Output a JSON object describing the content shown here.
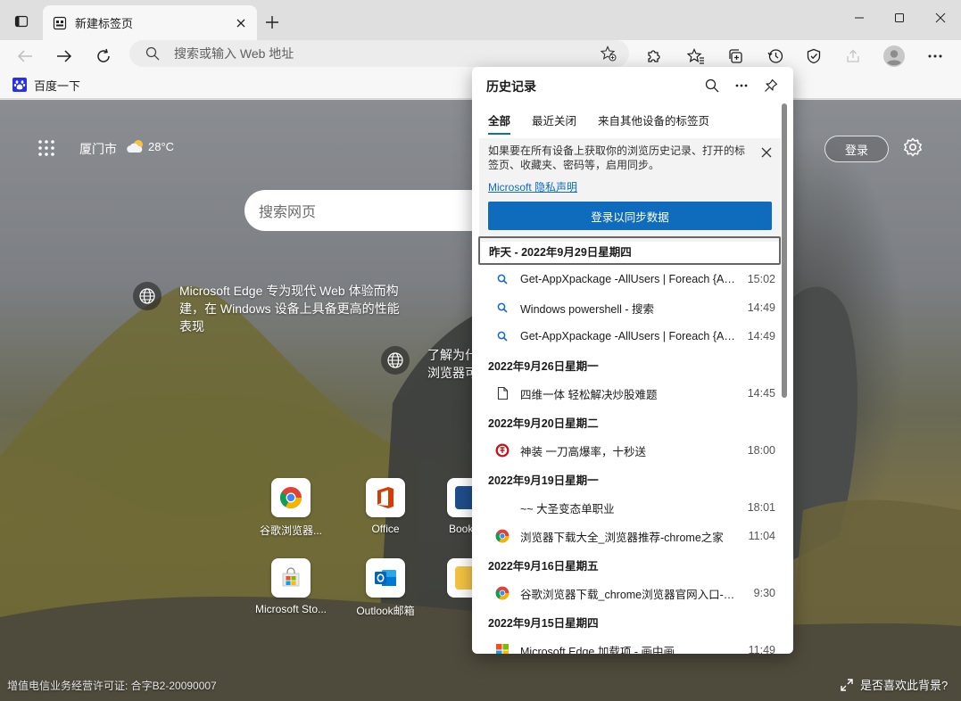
{
  "tab": {
    "title": "新建标签页"
  },
  "address": {
    "placeholder": "搜索或输入 Web 地址"
  },
  "favorites": [
    {
      "label": "百度一下"
    }
  ],
  "ntp": {
    "city": "厦门市",
    "temperature": "28°C",
    "login": "登录",
    "search_placeholder": "搜索网页",
    "promo1": "Microsoft Edge 专为现代 Web 体验而构建，在 Windows 设备上具备更高的性能表现",
    "promo2_line1": "了解为什",
    "promo2_line2": "浏览器可",
    "tiles": [
      {
        "label": "谷歌浏览器..."
      },
      {
        "label": "Office"
      },
      {
        "label": "Book"
      },
      {
        "label": "Microsoft Sto..."
      },
      {
        "label": "Outlook邮箱"
      }
    ],
    "license": "增值电信业务经营许可证: 合字B2-20090007",
    "bg_like": "是否喜欢此背景?"
  },
  "history": {
    "title": "历史记录",
    "tabs": [
      "全部",
      "最近关闭",
      "来自其他设备的标签页"
    ],
    "notice": "如果要在所有设备上获取你的浏览历史记录、打开的标签页、收藏夹、密码等，启用同步。",
    "privacy_link": "Microsoft 隐私声明",
    "sync_button": "登录以同步数据",
    "groups": [
      {
        "date": "昨天 - 2022年9月29日星期四",
        "items": [
          {
            "icon": "search",
            "title": "Get-AppXpackage -AllUsers | Foreach {Add-AppxPackage",
            "time": "15:02"
          },
          {
            "icon": "search",
            "title": "Windows powershell - 搜索",
            "time": "14:49"
          },
          {
            "icon": "search",
            "title": "Get-AppXpackage -AllUsers | Foreach {Add-AppxPackage",
            "time": "14:49"
          }
        ]
      },
      {
        "date": "2022年9月26日星期一",
        "items": [
          {
            "icon": "page",
            "title": "四维一体 轻松解决炒股难题",
            "time": "14:45"
          }
        ]
      },
      {
        "date": "2022年9月20日星期二",
        "items": [
          {
            "icon": "game",
            "title": "神装 一刀高爆率，十秒送",
            "time": "18:00"
          }
        ]
      },
      {
        "date": "2022年9月19日星期一",
        "items": [
          {
            "icon": "none",
            "title": "~~ 大圣变态单职业",
            "time": "18:01"
          },
          {
            "icon": "chrome",
            "title": "浏览器下载大全_浏览器推荐-chrome之家",
            "time": "11:04"
          }
        ]
      },
      {
        "date": "2022年9月16日星期五",
        "items": [
          {
            "icon": "chrome",
            "title": "谷歌浏览器下载_chrome浏览器官网入口-chrome之家",
            "time": "9:30"
          }
        ]
      },
      {
        "date": "2022年9月15日星期四",
        "items": [
          {
            "icon": "ms",
            "title": "Microsoft Edge 加载项 - 画中画",
            "time": "11:49"
          }
        ]
      }
    ]
  },
  "colors": {
    "accent": "#0f6cbd",
    "tabstrip": "#dfdfdf",
    "toolbar": "#f7f7f7"
  }
}
